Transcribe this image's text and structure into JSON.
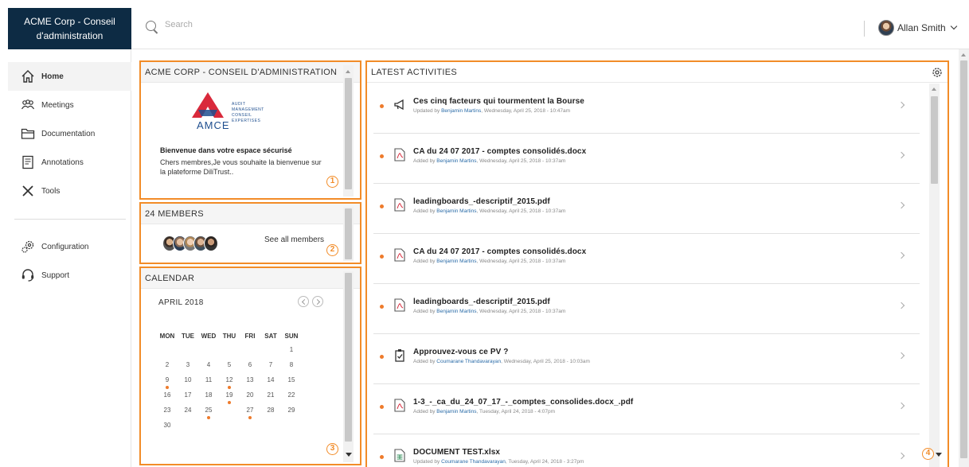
{
  "brand": {
    "title": "ACME Corp - Conseil d'administration"
  },
  "search": {
    "placeholder": "Search"
  },
  "user": {
    "name": "Allan Smith"
  },
  "sidebar": {
    "items": [
      {
        "label": "Home",
        "icon": "home-icon"
      },
      {
        "label": "Meetings",
        "icon": "meetings-icon"
      },
      {
        "label": "Documentation",
        "icon": "folder-icon"
      },
      {
        "label": "Annotations",
        "icon": "annotations-icon"
      },
      {
        "label": "Tools",
        "icon": "tools-icon"
      },
      {
        "label": "Configuration",
        "icon": "configuration-icon"
      },
      {
        "label": "Support",
        "icon": "support-icon"
      }
    ]
  },
  "welcome": {
    "header": "ACME CORP - CONSEIL D'ADMINISTRATION",
    "logo_text": "AMCE",
    "logo_lines": [
      "AUDIT",
      "MANAGEMENT",
      "CONSEIL",
      "EXPERTISES"
    ],
    "title": "Bienvenue dans votre espace sécurisé",
    "body": "Chers membres,Je vous souhaite la bienvenue sur la plateforme DiliTrust..",
    "marker": "1"
  },
  "members": {
    "header": "24 MEMBERS",
    "see_all": "See all members",
    "marker": "2"
  },
  "calendar": {
    "header": "CALENDAR",
    "month": "APRIL 2018",
    "weekdays": [
      "MON",
      "TUE",
      "WED",
      "THU",
      "FRI",
      "SAT",
      "SUN"
    ],
    "weeks": [
      [
        "",
        "",
        "",
        "",
        "",
        "",
        "1"
      ],
      [
        "2",
        "3",
        "4",
        "5",
        "6",
        "7",
        "8"
      ],
      [
        "9",
        "10",
        "11",
        "12",
        "13",
        "14",
        "15"
      ],
      [
        "16",
        "17",
        "18",
        "19",
        "20",
        "21",
        "22"
      ],
      [
        "23",
        "24",
        "25",
        "26",
        "27",
        "28",
        "29"
      ],
      [
        "30",
        "",
        "",
        "",
        "",
        "",
        ""
      ]
    ],
    "today": "26",
    "event_days": [
      "9",
      "12",
      "19",
      "25",
      "27"
    ],
    "marker": "3"
  },
  "activities": {
    "header": "LATEST ACTIVITIES",
    "marker": "4",
    "items": [
      {
        "title": "Ces cinq facteurs qui tourmentent la Bourse",
        "action": "Updated by",
        "who": "Benjamin Martins",
        "when": ", Wednesday, April 25, 2018 - 10:47am",
        "icon": "megaphone-icon"
      },
      {
        "title": "CA du 24 07 2017 - comptes consolidés.docx",
        "action": "Added by",
        "who": "Benjamin Martins",
        "when": ", Wednesday, April 25, 2018 - 10:37am",
        "icon": "pdf-icon"
      },
      {
        "title": "leadingboards_-descriptif_2015.pdf",
        "action": "Added by",
        "who": "Benjamin Martins",
        "when": ", Wednesday, April 25, 2018 - 10:37am",
        "icon": "pdf-icon"
      },
      {
        "title": "CA du 24 07 2017 - comptes consolidés.docx",
        "action": "Added by",
        "who": "Benjamin Martins",
        "when": ", Wednesday, April 25, 2018 - 10:37am",
        "icon": "pdf-icon"
      },
      {
        "title": "leadingboards_-descriptif_2015.pdf",
        "action": "Added by",
        "who": "Benjamin Martins",
        "when": ", Wednesday, April 25, 2018 - 10:37am",
        "icon": "pdf-icon"
      },
      {
        "title": "Approuvez-vous ce PV ?",
        "action": "Added by",
        "who": "Coumarane Thandavarayan",
        "when": ", Wednesday, April 25, 2018 - 10:03am",
        "icon": "vote-icon"
      },
      {
        "title": "1-3_-_ca_du_24_07_17_-_comptes_consolides.docx_.pdf",
        "action": "Added by",
        "who": "Benjamin Martins",
        "when": ", Tuesday, April 24, 2018 - 4:07pm",
        "icon": "pdf-icon"
      },
      {
        "title": "DOCUMENT TEST.xlsx",
        "action": "Updated by",
        "who": "Coumarane Thandavarayan",
        "when": ", Tuesday, April 24, 2018 - 3:27pm",
        "icon": "spreadsheet-icon"
      }
    ]
  },
  "colors": {
    "accent": "#f28c28",
    "brand_bg": "#0d2b44",
    "today": "#ee7b2c",
    "link": "#2b6ca8"
  }
}
